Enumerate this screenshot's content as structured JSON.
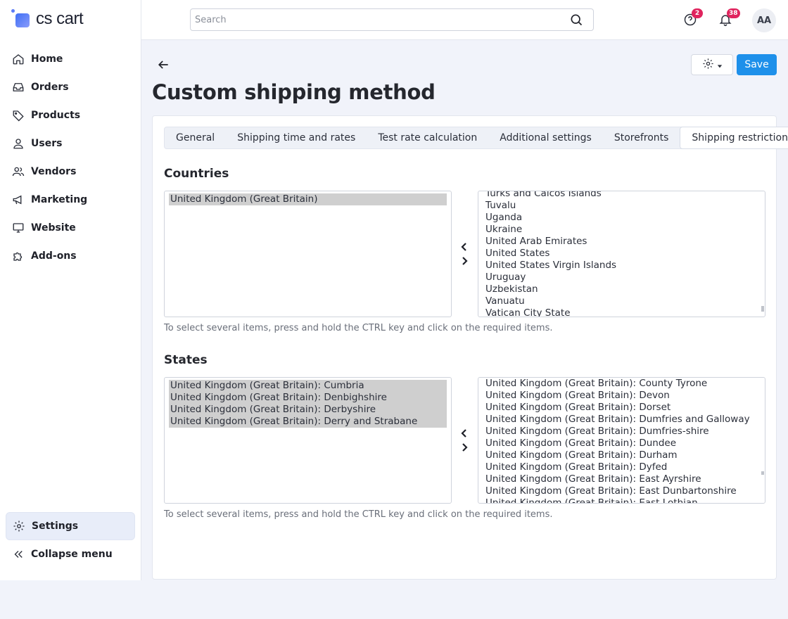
{
  "app": {
    "logo_text": "cs cart"
  },
  "sidebar": {
    "items": [
      {
        "label": "Home",
        "icon": "home-icon"
      },
      {
        "label": "Orders",
        "icon": "inbox-icon"
      },
      {
        "label": "Products",
        "icon": "tag-icon"
      },
      {
        "label": "Users",
        "icon": "user-icon"
      },
      {
        "label": "Vendors",
        "icon": "users-icon"
      },
      {
        "label": "Marketing",
        "icon": "megaphone-icon"
      },
      {
        "label": "Website",
        "icon": "monitor-icon"
      },
      {
        "label": "Add-ons",
        "icon": "puzzle-icon"
      }
    ],
    "settings_label": "Settings",
    "collapse_label": "Collapse menu"
  },
  "header": {
    "search_placeholder": "Search",
    "help_badge": "2",
    "notifications_badge": "38",
    "avatar_initials": "AA"
  },
  "page": {
    "title": "Custom shipping method",
    "save_label": "Save"
  },
  "tabs": [
    {
      "label": "General"
    },
    {
      "label": "Shipping time and rates"
    },
    {
      "label": "Test rate calculation"
    },
    {
      "label": "Additional settings"
    },
    {
      "label": "Storefronts"
    },
    {
      "label": "Shipping restrictions",
      "active": true
    }
  ],
  "countries": {
    "title": "Countries",
    "selected": [
      "United Kingdom (Great Britain)"
    ],
    "available": [
      "Turks and Caicos Islands",
      "Tuvalu",
      "Uganda",
      "Ukraine",
      "United Arab Emirates",
      "United States",
      "United States Virgin Islands",
      "Uruguay",
      "Uzbekistan",
      "Vanuatu",
      "Vatican City State"
    ],
    "hint": "To select several items, press and hold the CTRL key and click on the required items."
  },
  "states": {
    "title": "States",
    "selected": [
      "United Kingdom (Great Britain): Cumbria",
      "United Kingdom (Great Britain): Denbighshire",
      "United Kingdom (Great Britain): Derbyshire",
      "United Kingdom (Great Britain): Derry and Strabane"
    ],
    "available": [
      "United Kingdom (Great Britain): County Tyrone",
      "United Kingdom (Great Britain): Devon",
      "United Kingdom (Great Britain): Dorset",
      "United Kingdom (Great Britain): Dumfries and Galloway",
      "United Kingdom (Great Britain): Dumfries-shire",
      "United Kingdom (Great Britain): Dundee",
      "United Kingdom (Great Britain): Durham",
      "United Kingdom (Great Britain): Dyfed",
      "United Kingdom (Great Britain): East Ayrshire",
      "United Kingdom (Great Britain): East Dunbartonshire",
      "United Kingdom (Great Britain): East Lothian"
    ],
    "hint": "To select several items, press and hold the CTRL key and click on the required items."
  },
  "colors": {
    "primary": "#1e90ea",
    "badge": "#e0245e",
    "selected_option": "#cfcfcf"
  }
}
